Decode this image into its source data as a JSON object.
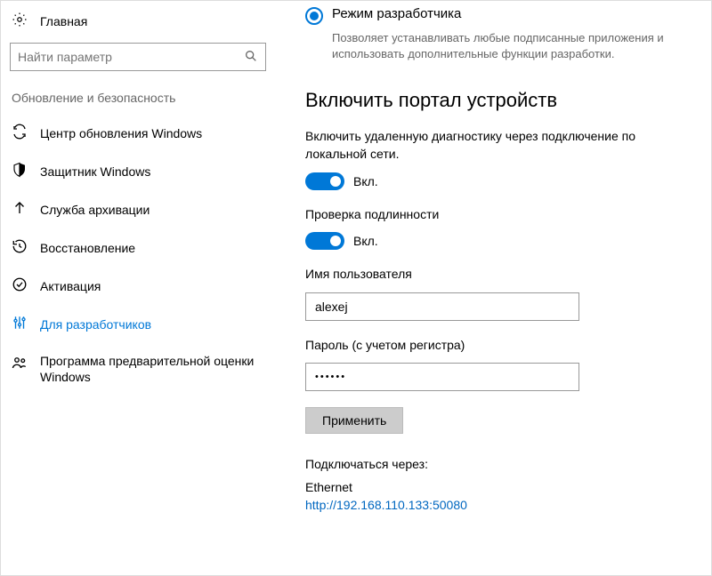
{
  "sidebar": {
    "home": "Главная",
    "search_placeholder": "Найти параметр",
    "section": "Обновление и безопасность",
    "items": [
      {
        "label": "Центр обновления Windows"
      },
      {
        "label": "Защитник Windows"
      },
      {
        "label": "Служба архивации"
      },
      {
        "label": "Восстановление"
      },
      {
        "label": "Активация"
      },
      {
        "label": "Для разработчиков"
      },
      {
        "label": "Программа предварительной оценки Windows"
      }
    ]
  },
  "content": {
    "radio_label": "Режим разработчика",
    "radio_desc": "Позволяет устанавливать любые подписанные приложения и использовать дополнительные функции разработки.",
    "heading": "Включить портал устройств",
    "remote_diag_label": "Включить удаленную диагностику через подключение по локальной сети.",
    "toggle_on": "Вкл.",
    "auth_label": "Проверка подлинности",
    "username_label": "Имя пользователя",
    "username_value": "alexej",
    "password_label": "Пароль (с учетом регистра)",
    "password_mask": "••••••",
    "apply": "Применить",
    "connect_label": "Подключаться через:",
    "connect_type": "Ethernet",
    "connect_url": "http://192.168.110.133:50080"
  }
}
